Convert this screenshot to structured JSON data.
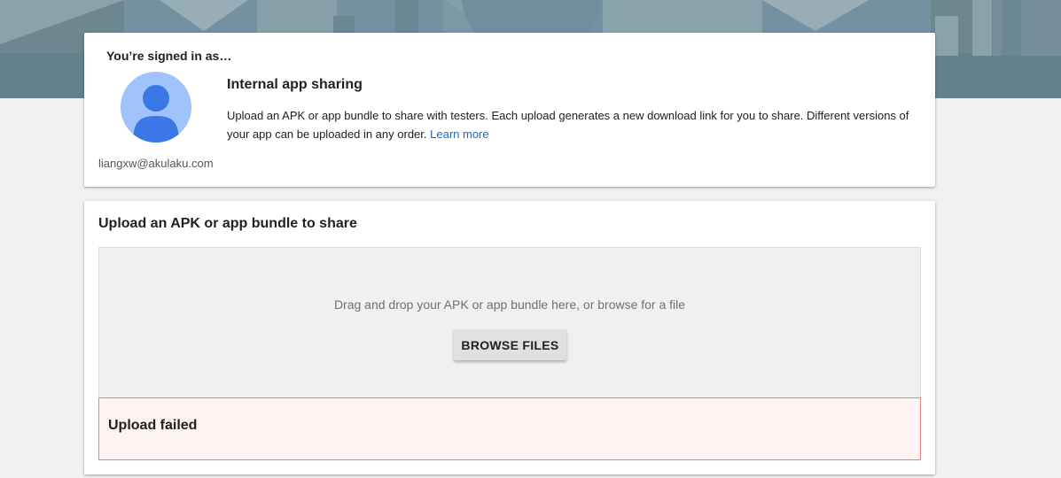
{
  "signin": {
    "label": "You’re signed in as…",
    "email": "liangxw@akulaku.com"
  },
  "intro": {
    "title": "Internal app sharing",
    "description": "Upload an APK or app bundle to share with testers. Each upload generates a new download link for you to share. Different versions of your app can be uploaded in any order.",
    "learn_more": "Learn more"
  },
  "upload": {
    "title": "Upload an APK or app bundle to share",
    "drop_hint": "Drag and drop your APK or app bundle here, or browse for a file",
    "browse_label": "BROWSE FILES",
    "error": "Upload failed"
  },
  "colors": {
    "banner": "#6d8791",
    "avatar_bg": "#a0c3fb",
    "avatar_figure": "#3b78e7",
    "link": "#1a67c8",
    "error_bg": "#fdf3f2",
    "error_border": "#e08683"
  },
  "icons": {
    "avatar": "person-icon"
  }
}
